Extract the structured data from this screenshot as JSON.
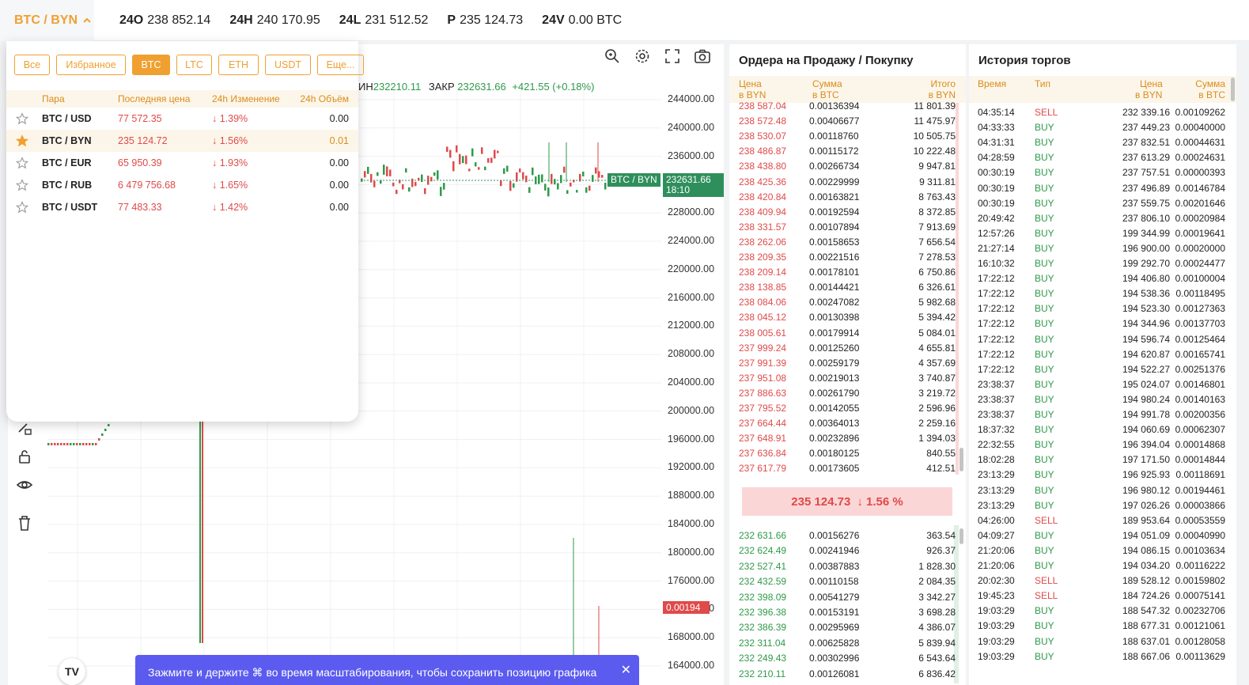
{
  "header": {
    "pair": "BTC / BYN",
    "stats": [
      {
        "label": "24O",
        "value": "238 852.14"
      },
      {
        "label": "24H",
        "value": "240 170.95"
      },
      {
        "label": "24L",
        "value": "231 512.52"
      },
      {
        "label": "P",
        "value": "235 124.73"
      },
      {
        "label": "24V",
        "value": "0.00 BTC"
      }
    ]
  },
  "chart": {
    "ohlc_text": "ИН",
    "ohlc_low": "232210.11",
    "close_label": "ЗАКР",
    "close_value": "232631.66",
    "change": "+421.55 (+0.18%)",
    "pair_tag": "BTC / BYN",
    "price_tag": "232631.66",
    "price_time": "18:10",
    "volume_tag": "0.00194",
    "y_labels": [
      "244000.00",
      "240000.00",
      "236000.00",
      "232000.00",
      "228000.00",
      "224000.00",
      "220000.00",
      "216000.00",
      "212000.00",
      "208000.00",
      "204000.00",
      "200000.00",
      "196000.00",
      "192000.00",
      "188000.00",
      "184000.00",
      "180000.00",
      "176000.00",
      "172000.00",
      "168000.00",
      "164000.00"
    ],
    "toast": "Зажмите и держите ⌘ во время масштабирования, чтобы сохранить позицию графика",
    "logo_text": "TV"
  },
  "dropdown": {
    "tabs": [
      "Все",
      "Избранное",
      "BTC",
      "LTC",
      "ETH",
      "USDT",
      "Еще..."
    ],
    "active_tab": "BTC",
    "columns": [
      "Пара",
      "Последняя цена",
      "24h Изменение",
      "24h Объём"
    ],
    "rows": [
      {
        "pair": "BTC / USD",
        "last": "77 572.35",
        "change": "↓ 1.39%",
        "volume": "0.00",
        "fav": false
      },
      {
        "pair": "BTC / BYN",
        "last": "235 124.72",
        "change": "↓ 1.56%",
        "volume": "0.01",
        "fav": true
      },
      {
        "pair": "BTC / EUR",
        "last": "65 950.39",
        "change": "↓ 1.93%",
        "volume": "0.00",
        "fav": false
      },
      {
        "pair": "BTC / RUB",
        "last": "6 479 756.68",
        "change": "↓ 1.65%",
        "volume": "0.00",
        "fav": false
      },
      {
        "pair": "BTC / USDT",
        "last": "77 483.33",
        "change": "↓ 1.42%",
        "volume": "0.00",
        "fav": false
      }
    ]
  },
  "orderbook": {
    "title": "Ордера на Продажу / Покупку",
    "col_price": [
      "Цена",
      "в BYN"
    ],
    "col_amount": [
      "Сумма",
      "в BTC"
    ],
    "col_total": [
      "Итого",
      "в BYN"
    ],
    "sells": [
      [
        "238 587.04",
        "0.00136394",
        "11 801.39"
      ],
      [
        "238 572.48",
        "0.00406677",
        "11 475.97"
      ],
      [
        "238 530.07",
        "0.00118760",
        "10 505.75"
      ],
      [
        "238 486.87",
        "0.00115172",
        "10 222.48"
      ],
      [
        "238 438.80",
        "0.00266734",
        "9 947.81"
      ],
      [
        "238 425.36",
        "0.00229999",
        "9 311.81"
      ],
      [
        "238 420.84",
        "0.00163821",
        "8 763.43"
      ],
      [
        "238 409.94",
        "0.00192594",
        "8 372.85"
      ],
      [
        "238 331.57",
        "0.00107894",
        "7 913.69"
      ],
      [
        "238 262.06",
        "0.00158653",
        "7 656.54"
      ],
      [
        "238 209.35",
        "0.00221516",
        "7 278.53"
      ],
      [
        "238 209.14",
        "0.00178101",
        "6 750.86"
      ],
      [
        "238 138.85",
        "0.00144421",
        "6 326.61"
      ],
      [
        "238 084.06",
        "0.00247082",
        "5 982.68"
      ],
      [
        "238 045.12",
        "0.00130398",
        "5 394.42"
      ],
      [
        "238 005.61",
        "0.00179914",
        "5 084.01"
      ],
      [
        "237 999.24",
        "0.00125260",
        "4 655.81"
      ],
      [
        "237 991.39",
        "0.00259179",
        "4 357.69"
      ],
      [
        "237 951.08",
        "0.00219013",
        "3 740.87"
      ],
      [
        "237 886.63",
        "0.00261790",
        "3 219.72"
      ],
      [
        "237 795.52",
        "0.00142055",
        "2 596.96"
      ],
      [
        "237 664.44",
        "0.00364013",
        "2 259.16"
      ],
      [
        "237 648.91",
        "0.00232896",
        "1 394.03"
      ],
      [
        "237 636.84",
        "0.00180125",
        "840.55"
      ],
      [
        "237 617.79",
        "0.00173605",
        "412.51"
      ]
    ],
    "mid_price": "235 124.73",
    "mid_change": "↓  1.56 %",
    "buys": [
      [
        "232 631.66",
        "0.00156276",
        "363.54"
      ],
      [
        "232 624.49",
        "0.00241946",
        "926.37"
      ],
      [
        "232 527.41",
        "0.00387883",
        "1 828.30"
      ],
      [
        "232 432.59",
        "0.00110158",
        "2 084.35"
      ],
      [
        "232 398.09",
        "0.00541279",
        "3 342.27"
      ],
      [
        "232 396.38",
        "0.00153191",
        "3 698.28"
      ],
      [
        "232 386.39",
        "0.00295969",
        "4 386.07"
      ],
      [
        "232 311.04",
        "0.00625828",
        "5 839.94"
      ],
      [
        "232 249.43",
        "0.00302996",
        "6 543.64"
      ],
      [
        "232 210.11",
        "0.00126081",
        "6 836.42"
      ]
    ]
  },
  "history": {
    "title": "История торгов",
    "col_time": "Время",
    "col_type": "Тип",
    "col_price": [
      "Цена",
      "в BYN"
    ],
    "col_amount": [
      "Сумма",
      "в BTC"
    ],
    "rows": [
      [
        "04:35:14",
        "SELL",
        "232 339.16",
        "0.00109262"
      ],
      [
        "04:33:33",
        "BUY",
        "237 449.23",
        "0.00040000"
      ],
      [
        "04:31:31",
        "BUY",
        "237 832.51",
        "0.00044631"
      ],
      [
        "04:28:59",
        "BUY",
        "237 613.29",
        "0.00024631"
      ],
      [
        "00:30:19",
        "BUY",
        "237 757.51",
        "0.00000393"
      ],
      [
        "00:30:19",
        "BUY",
        "237 496.89",
        "0.00146784"
      ],
      [
        "00:30:19",
        "BUY",
        "237 559.75",
        "0.00201646"
      ],
      [
        "20:49:42",
        "BUY",
        "237 806.10",
        "0.00020984"
      ],
      [
        "12:57:26",
        "BUY",
        "199 344.99",
        "0.00019641"
      ],
      [
        "21:27:14",
        "BUY",
        "196 900.00",
        "0.00020000"
      ],
      [
        "16:10:32",
        "BUY",
        "199 292.70",
        "0.00024477"
      ],
      [
        "17:22:12",
        "BUY",
        "194 406.80",
        "0.00100004"
      ],
      [
        "17:22:12",
        "BUY",
        "194 538.36",
        "0.00118495"
      ],
      [
        "17:22:12",
        "BUY",
        "194 523.30",
        "0.00127363"
      ],
      [
        "17:22:12",
        "BUY",
        "194 344.96",
        "0.00137703"
      ],
      [
        "17:22:12",
        "BUY",
        "194 596.74",
        "0.00125464"
      ],
      [
        "17:22:12",
        "BUY",
        "194 620.87",
        "0.00165741"
      ],
      [
        "17:22:12",
        "BUY",
        "194 522.27",
        "0.00251376"
      ],
      [
        "23:38:37",
        "BUY",
        "195 024.07",
        "0.00146801"
      ],
      [
        "23:38:37",
        "BUY",
        "194 980.24",
        "0.00140163"
      ],
      [
        "23:38:37",
        "BUY",
        "194 991.78",
        "0.00200356"
      ],
      [
        "18:37:32",
        "BUY",
        "194 060.69",
        "0.00062307"
      ],
      [
        "22:32:55",
        "BUY",
        "196 394.04",
        "0.00014868"
      ],
      [
        "18:02:28",
        "BUY",
        "197 171.50",
        "0.00014844"
      ],
      [
        "23:13:29",
        "BUY",
        "196 925.93",
        "0.00118691"
      ],
      [
        "23:13:29",
        "BUY",
        "196 980.12",
        "0.00194461"
      ],
      [
        "23:13:29",
        "BUY",
        "197 026.26",
        "0.00003866"
      ],
      [
        "04:26:00",
        "SELL",
        "189 953.64",
        "0.00053559"
      ],
      [
        "04:09:27",
        "BUY",
        "194 051.09",
        "0.00040990"
      ],
      [
        "21:20:06",
        "BUY",
        "194 086.15",
        "0.00103634"
      ],
      [
        "21:20:06",
        "BUY",
        "194 034.20",
        "0.00116222"
      ],
      [
        "20:02:30",
        "SELL",
        "189 528.12",
        "0.00159802"
      ],
      [
        "19:45:23",
        "SELL",
        "184 724.26",
        "0.00075141"
      ],
      [
        "19:03:29",
        "BUY",
        "188 547.32",
        "0.00232706"
      ],
      [
        "19:03:29",
        "BUY",
        "188 677.31",
        "0.00121061"
      ],
      [
        "19:03:29",
        "BUY",
        "188 637.01",
        "0.00128058"
      ],
      [
        "19:03:29",
        "BUY",
        "188 667.06",
        "0.00113629"
      ]
    ]
  },
  "colors": {
    "accent": "#f0a030",
    "sell": "#e04a4a",
    "buy": "#2e9a4a",
    "toast": "#5b5bf0"
  }
}
